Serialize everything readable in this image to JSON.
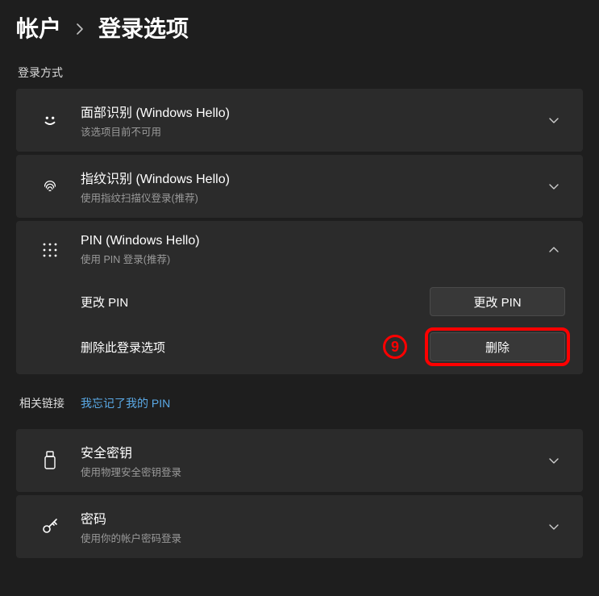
{
  "breadcrumb": {
    "parent": "帐户",
    "current": "登录选项"
  },
  "section_heading": "登录方式",
  "items": [
    {
      "title": "面部识别 (Windows Hello)",
      "subtitle": "该选项目前不可用"
    },
    {
      "title": "指纹识别 (Windows Hello)",
      "subtitle": "使用指纹扫描仪登录(推荐)"
    },
    {
      "title": "PIN (Windows Hello)",
      "subtitle": "使用 PIN 登录(推荐)"
    },
    {
      "title": "安全密钥",
      "subtitle": "使用物理安全密钥登录"
    },
    {
      "title": "密码",
      "subtitle": "使用你的帐户密码登录"
    }
  ],
  "pin_rows": {
    "change_label": "更改 PIN",
    "change_button": "更改 PIN",
    "remove_label": "删除此登录选项",
    "remove_button": "删除"
  },
  "annotation": {
    "number": "9"
  },
  "related": {
    "label": "相关链接",
    "link": "我忘记了我的 PIN"
  }
}
